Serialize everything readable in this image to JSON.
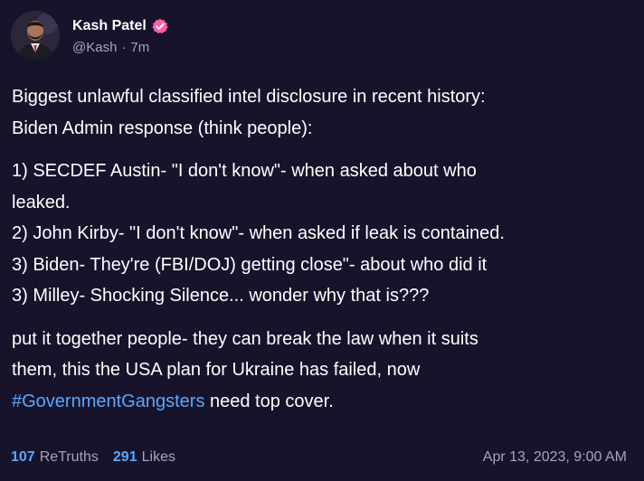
{
  "author": {
    "display_name": "Kash Patel",
    "handle": "@Kash",
    "separator": "·",
    "relative_time": "7m",
    "verified_color": "#ff5fa2"
  },
  "post": {
    "paragraphs": [
      [
        "Biggest unlawful classified intel disclosure in recent history:",
        "Biden Admin response (think people):"
      ],
      [
        "1) SECDEF Austin- \"I don't know\"- when asked about who",
        "leaked.",
        "2) John Kirby- \"I don't know\"- when asked if leak is contained.",
        "3) Biden- They're (FBI/DOJ) getting close\"- about who did it",
        "3) Milley- Shocking Silence... wonder why that is???"
      ],
      [
        "put it together people- they can break the law when it suits",
        "them, this the USA plan for Ukraine has failed, now"
      ]
    ],
    "hashtag": "#GovernmentGangsters",
    "after_hashtag": " need top cover."
  },
  "stats": {
    "retruths_count": "107",
    "retruths_label": "ReTruths",
    "likes_count": "291",
    "likes_label": "Likes"
  },
  "timestamp": "Apr 13, 2023, 9:00 AM",
  "colors": {
    "background": "#17132b",
    "text": "#ffffff",
    "muted": "#a7a3bd",
    "link": "#5aa8ff"
  }
}
